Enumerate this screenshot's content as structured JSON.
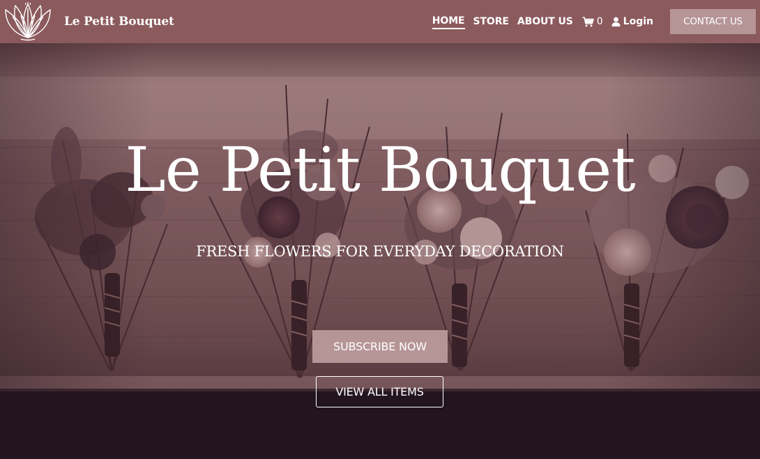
{
  "brand": {
    "name": "Le Petit Bouquet",
    "logo_icon": "lotus-logo-icon"
  },
  "nav": {
    "items": [
      {
        "label": "HOME",
        "active": true
      },
      {
        "label": "STORE",
        "active": false
      },
      {
        "label": "ABOUT US",
        "active": false
      }
    ],
    "cart": {
      "icon": "cart-icon",
      "count": "0"
    },
    "login": {
      "icon": "user-icon",
      "label": "Login"
    },
    "contact_label": "CONTACT US"
  },
  "hero": {
    "title": "Le Petit Bouquet",
    "subtitle": "FRESH FLOWERS FOR EVERYDAY DECORATION",
    "subscribe_label": "SUBSCRIBE NOW",
    "view_all_label": "VIEW ALL ITEMS",
    "background": "boutonniere-bouquets-on-wooden-board-photo"
  },
  "colors": {
    "navbar": "#8b5a5d",
    "accent_button": "#b69597",
    "footer_dark": "#221520",
    "text": "#ffffff"
  }
}
